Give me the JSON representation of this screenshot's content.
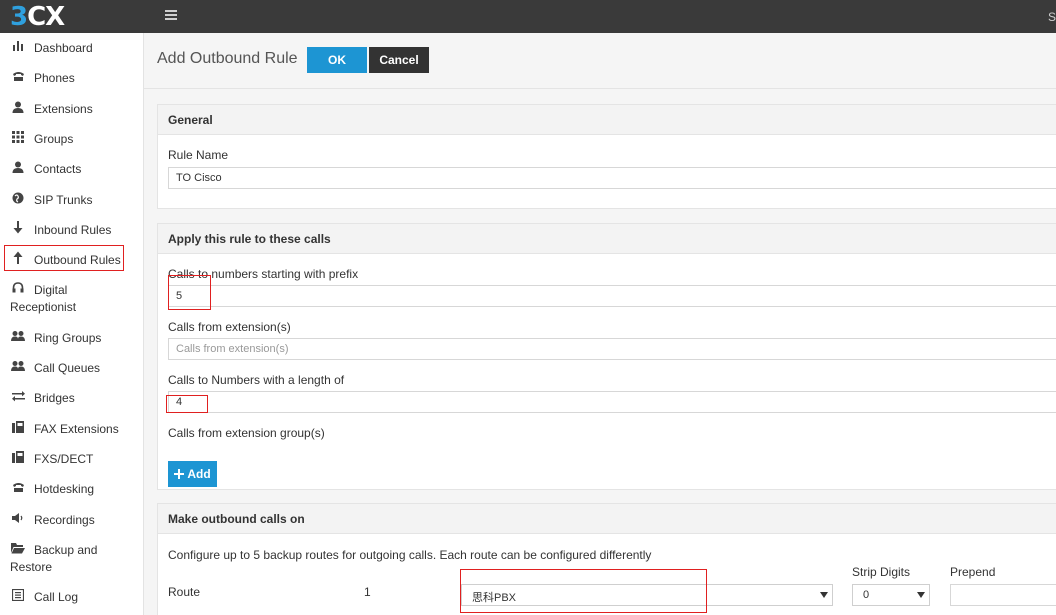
{
  "brand": {
    "logo_part1": "3",
    "logo_part2": "CX",
    "topbar_right": "S"
  },
  "sidebar": {
    "items": [
      {
        "label": "Dashboard",
        "icon": "bar-chart-icon"
      },
      {
        "label": "Phones",
        "icon": "phone-icon"
      },
      {
        "label": "Extensions",
        "icon": "user-icon"
      },
      {
        "label": "Groups",
        "icon": "grid-icon"
      },
      {
        "label": "Contacts",
        "icon": "contact-icon"
      },
      {
        "label": "SIP Trunks",
        "icon": "globe-icon"
      },
      {
        "label": "Inbound Rules",
        "icon": "arrow-down-icon"
      },
      {
        "label": "Outbound Rules",
        "icon": "arrow-up-icon"
      },
      {
        "label": "Digital",
        "label2": "Receptionist",
        "icon": "headset-icon"
      },
      {
        "label": "Ring Groups",
        "icon": "users-icon"
      },
      {
        "label": "Call Queues",
        "icon": "users-icon"
      },
      {
        "label": "Bridges",
        "icon": "exchange-icon"
      },
      {
        "label": "FAX Extensions",
        "icon": "fax-icon"
      },
      {
        "label": "FXS/DECT",
        "icon": "fax-icon"
      },
      {
        "label": "Hotdesking",
        "icon": "phone-icon"
      },
      {
        "label": "Recordings",
        "icon": "speaker-icon"
      },
      {
        "label": "Backup and",
        "label2": "Restore",
        "icon": "folder-icon"
      },
      {
        "label": "Call Log",
        "icon": "list-icon"
      }
    ]
  },
  "header": {
    "title": "Add Outbound Rule",
    "ok_label": "OK",
    "cancel_label": "Cancel"
  },
  "general": {
    "heading": "General",
    "rule_name_label": "Rule Name",
    "rule_name_value": "TO Cisco"
  },
  "apply": {
    "heading": "Apply this rule to these calls",
    "prefix_label": "Calls to numbers starting with prefix",
    "prefix_value": "5",
    "from_ext_label": "Calls from extension(s)",
    "from_ext_placeholder": "Calls from extension(s)",
    "length_label": "Calls to Numbers with a length of",
    "length_value": "4",
    "ext_group_label": "Calls from extension group(s)",
    "add_label": "Add"
  },
  "outbound": {
    "heading": "Make outbound calls on",
    "description": "Configure up to 5 backup routes for outgoing calls. Each route can be configured differently",
    "strip_digits_label": "Strip Digits",
    "prepend_label": "Prepend",
    "route_label": "Route",
    "route_number": "1",
    "route_value": "思科PBX",
    "strip_value": "0",
    "prepend_value": ""
  },
  "colors": {
    "accent": "#1d95d3",
    "topbar": "#3a3a3a",
    "highlight": "#e02020",
    "cancel": "#333333"
  }
}
